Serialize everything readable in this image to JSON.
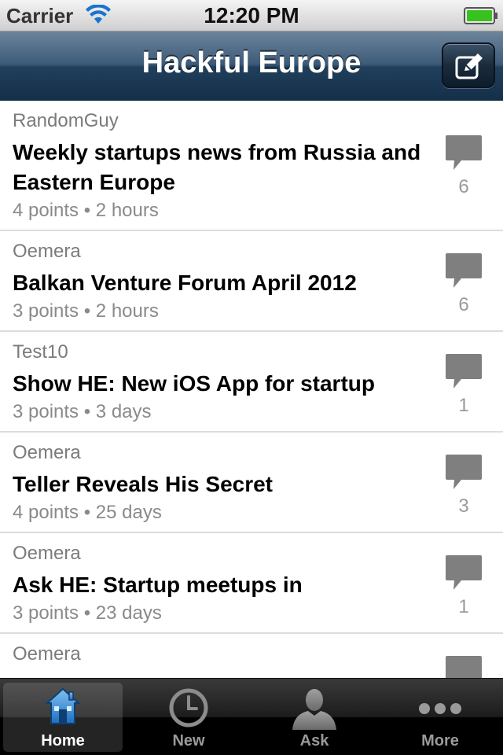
{
  "status_bar": {
    "carrier": "Carrier",
    "time": "12:20 PM"
  },
  "nav": {
    "title": "Hackful Europe",
    "compose_icon": "compose-icon"
  },
  "stories": [
    {
      "author": "RandomGuy",
      "title": "Weekly startups news from Russia and Eastern Europe",
      "meta": "4 points • 2 hours",
      "comments": "6"
    },
    {
      "author": "Oemera",
      "title": "Balkan Venture Forum April 2012",
      "meta": "3 points • 2 hours",
      "comments": "6"
    },
    {
      "author": "Test10",
      "title": "Show HE: New iOS App for startup",
      "meta": "3 points • 3 days",
      "comments": "1"
    },
    {
      "author": "Oemera",
      "title": "Teller Reveals His Secret",
      "meta": "4 points • 25 days",
      "comments": "3"
    },
    {
      "author": "Oemera",
      "title": "Ask HE: Startup meetups in",
      "meta": "3 points • 23 days",
      "comments": "1"
    },
    {
      "author": "Oemera"
    }
  ],
  "tabs": [
    {
      "label": "Home",
      "icon": "home-icon",
      "active": true
    },
    {
      "label": "New",
      "icon": "clock-icon",
      "active": false
    },
    {
      "label": "Ask",
      "icon": "person-icon",
      "active": false
    },
    {
      "label": "More",
      "icon": "more-dots-icon",
      "active": false
    }
  ],
  "colors": {
    "nav_bar": "#2c4a66",
    "tab_bar": "#1c1c1c",
    "active_tab_icon": "#3a8fd6",
    "comment_icon": "#7f7f7f"
  }
}
